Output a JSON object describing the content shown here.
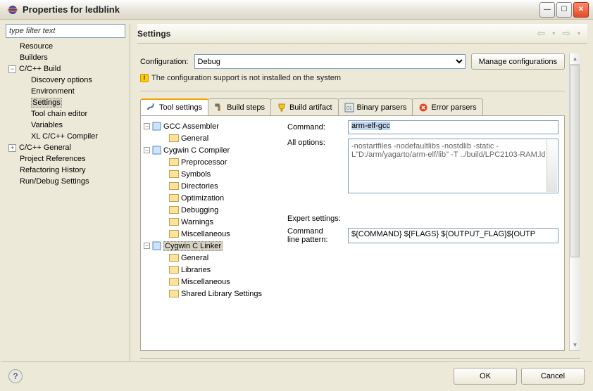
{
  "window": {
    "title": "Properties for ledblink"
  },
  "filter": {
    "placeholder": "type filter text"
  },
  "nav": {
    "resource": "Resource",
    "builders": "Builders",
    "ccbuild": "C/C++ Build",
    "discovery": "Discovery options",
    "environment": "Environment",
    "settings": "Settings",
    "toolchain": "Tool chain editor",
    "variables": "Variables",
    "xlcomp": "XL C/C++ Compiler",
    "ccgen": "C/C++ General",
    "projref": "Project References",
    "refactor": "Refactoring History",
    "rundebug": "Run/Debug Settings"
  },
  "panel": {
    "title": "Settings",
    "config_label": "Configuration:",
    "config_value": "Debug",
    "manage_btn": "Manage configurations",
    "warning": "The configuration support is not installed on the system"
  },
  "tabs": {
    "tool": "Tool settings",
    "steps": "Build steps",
    "artifact": "Build artifact",
    "binary": "Binary parsers",
    "error": "Error parsers"
  },
  "tooltree": {
    "gccasm": "GCC Assembler",
    "general": "General",
    "cygc": "Cygwin C Compiler",
    "preproc": "Preprocessor",
    "symbols": "Symbols",
    "dirs": "Directories",
    "optim": "Optimization",
    "debug": "Debugging",
    "warn": "Warnings",
    "misc": "Miscellaneous",
    "cyglink": "Cygwin C Linker",
    "libs": "Libraries",
    "shared": "Shared Library Settings"
  },
  "detail": {
    "command_label": "Command:",
    "command_value": "arm-elf-gcc",
    "allopts_label": "All options:",
    "allopts_value": "-nostartfiles -nodefaultlibs -nostdlib -static -L\"D:/arm/yagarto/arm-elf/lib\" -T ../build/LPC2103-RAM.ld",
    "expert_label": "Expert settings:",
    "pattern_label": "Command\nline pattern:",
    "pattern_value": "${COMMAND} ${FLAGS} ${OUTPUT_FLAG}${OUTP"
  },
  "buttons": {
    "ok": "OK",
    "cancel": "Cancel"
  }
}
